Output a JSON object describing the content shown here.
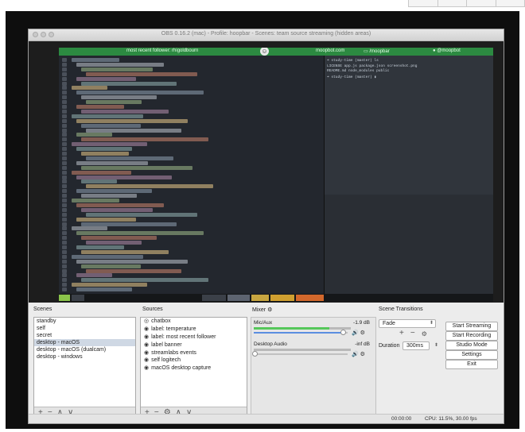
{
  "window": {
    "title": "OBS 0.16.2 (mac) - Profile: hoopbar - Scenes: team source streaming (hidden areas)"
  },
  "stream_overlay": {
    "banner_text": "most recent follower: rhigoldbourn",
    "site": "moopbot.com",
    "handle_mid": "/moopbar",
    "handle_right": "@moopbot"
  },
  "scenes": {
    "label": "Scenes",
    "items": [
      {
        "label": "standby",
        "selected": false
      },
      {
        "label": "self",
        "selected": false
      },
      {
        "label": "secret",
        "selected": false
      },
      {
        "label": "desktop - macOS",
        "selected": true
      },
      {
        "label": "desktop - macOS (dualcam)",
        "selected": false
      },
      {
        "label": "desktop - windows",
        "selected": false
      }
    ],
    "footer": {
      "add": "+",
      "remove": "−",
      "up": "∧",
      "down": "∨"
    }
  },
  "sources": {
    "label": "Sources",
    "items": [
      {
        "label": "chatbox",
        "visible": false
      },
      {
        "label": "label: temperature",
        "visible": true
      },
      {
        "label": "label: most recent follower",
        "visible": true
      },
      {
        "label": "label banner",
        "visible": true
      },
      {
        "label": "streamlabs events",
        "visible": true
      },
      {
        "label": "self logitech",
        "visible": true
      },
      {
        "label": "macOS desktop capture",
        "visible": true
      }
    ],
    "footer": {
      "add": "+",
      "remove": "−",
      "settings": "⚙",
      "up": "∧",
      "down": "∨"
    }
  },
  "mixer": {
    "label": "Mixer",
    "channels": [
      {
        "name": "Mic/Aux",
        "db": "-1.9 dB",
        "meter_level": 0.78,
        "volume": 0.96
      },
      {
        "name": "Desktop Audio",
        "db": "-inf dB",
        "meter_level": 0.0,
        "volume": 0.02
      }
    ]
  },
  "transitions": {
    "label": "Scene Transitions",
    "type": "Fade",
    "add": "+",
    "remove": "−",
    "duration_label": "Duration",
    "duration_value": "300ms"
  },
  "controls": {
    "start_streaming": "Start Streaming",
    "start_recording": "Start Recording",
    "studio_mode": "Studio Mode",
    "settings": "Settings",
    "exit": "Exit"
  },
  "status": {
    "time": "00:00:00",
    "cpu": "CPU: 11.5%, 30.00 fps"
  },
  "colors": {
    "banner_green": "#2c8a41",
    "selection": "#cfd8e4",
    "meter_green": "#55c75a",
    "slider_blue": "#5b8ee0"
  },
  "icons": {
    "visibility": "eye-icon",
    "hidden": "eye-slash-icon",
    "gear": "gear-icon",
    "speaker": "speaker-icon"
  }
}
